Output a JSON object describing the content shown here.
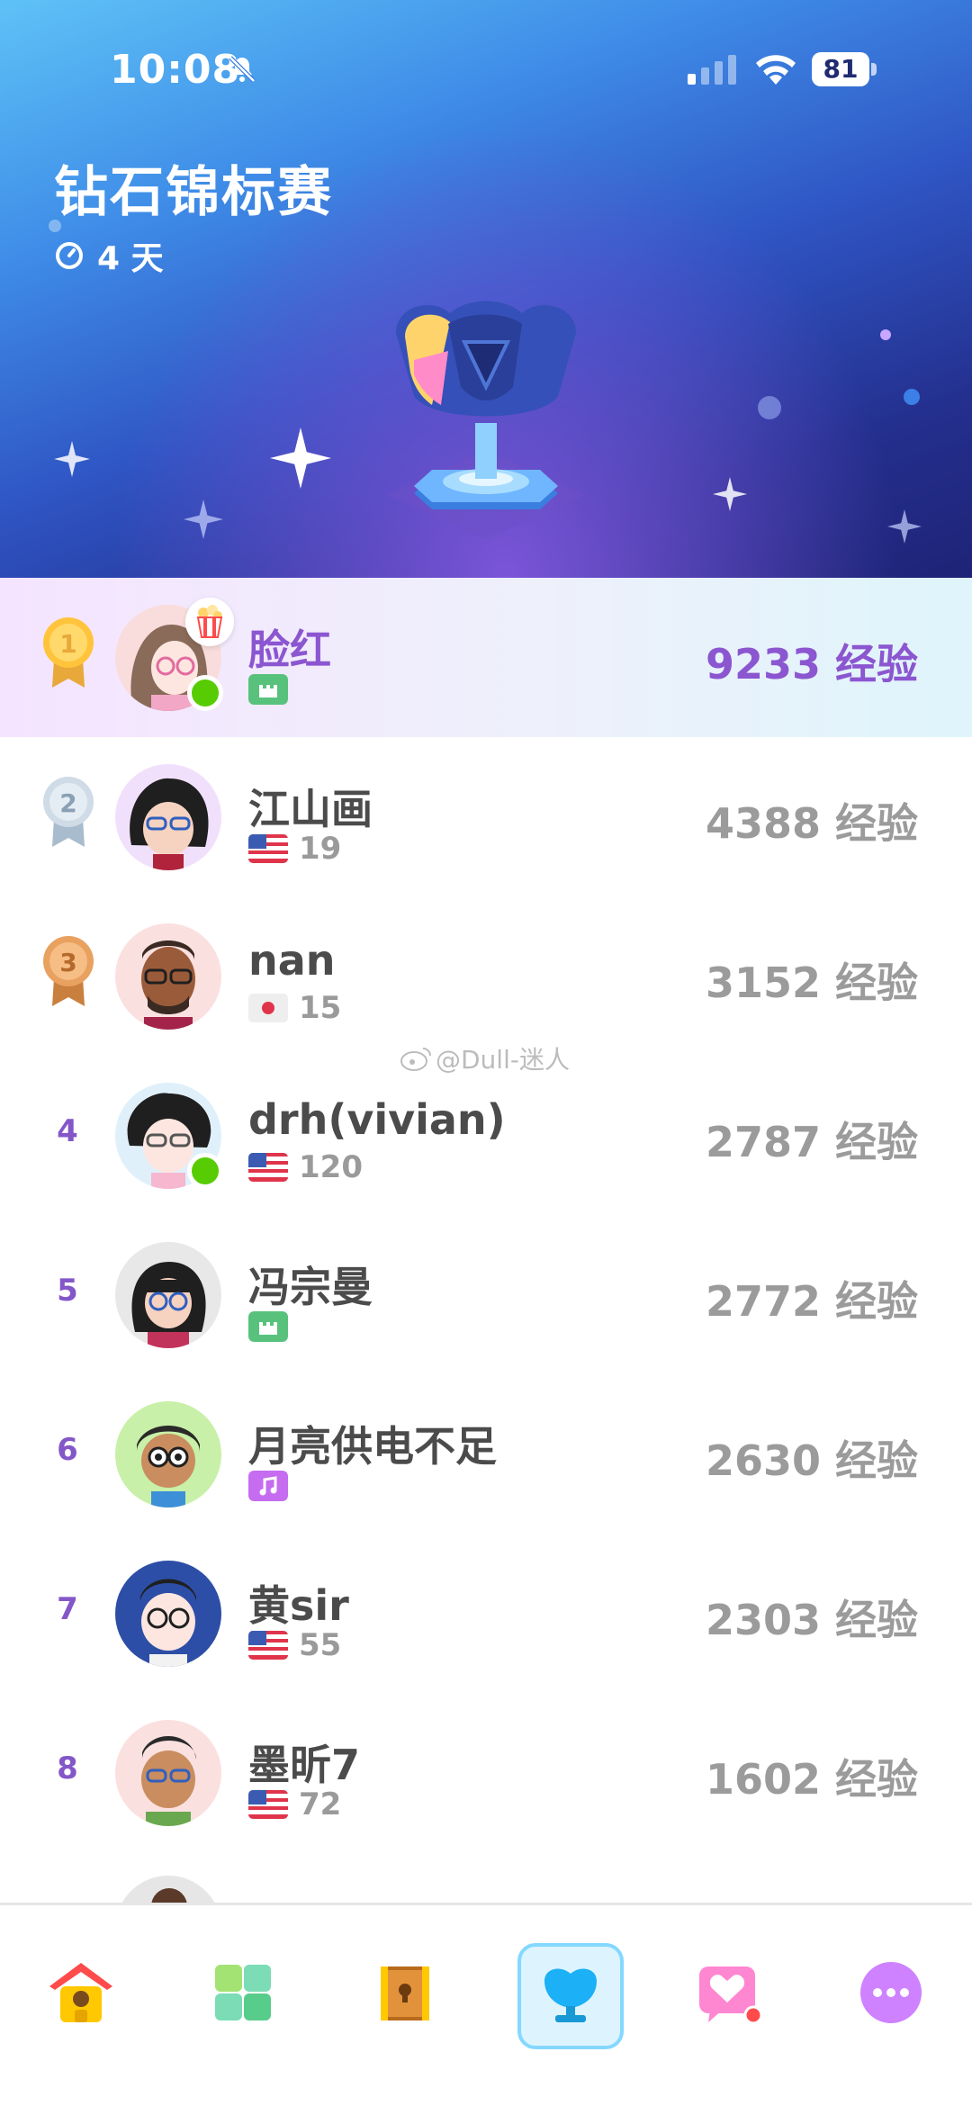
{
  "status_bar": {
    "time": "10:08",
    "battery": "81"
  },
  "header": {
    "title": "钻石锦标赛",
    "timer": "4 天"
  },
  "leaderboard": [
    {
      "rank": "1",
      "name": "脸红",
      "xp": "9233 经验",
      "sub_type": "tag",
      "tag_color": "#58c27d",
      "is_me": true,
      "online": true
    },
    {
      "rank": "2",
      "name": "江山画",
      "xp": "4388 经验",
      "sub_type": "flag",
      "flag": "us",
      "streak": "19"
    },
    {
      "rank": "3",
      "name": "nan",
      "xp": "3152 经验",
      "sub_type": "flag",
      "flag": "jp",
      "streak": "15"
    },
    {
      "rank": "4",
      "name": "drh(vivian)",
      "xp": "2787 经验",
      "sub_type": "flag",
      "flag": "us",
      "streak": "120",
      "online": true
    },
    {
      "rank": "5",
      "name": "冯宗曼",
      "xp": "2772 经验",
      "sub_type": "tag",
      "tag_color": "#58c27d"
    },
    {
      "rank": "6",
      "name": "月亮供电不足",
      "xp": "2630 经验",
      "sub_type": "tag",
      "tag_color": "#c56cf0"
    },
    {
      "rank": "7",
      "name": "黄sir",
      "xp": "2303 经验",
      "sub_type": "flag",
      "flag": "us",
      "streak": "55"
    },
    {
      "rank": "8",
      "name": "墨昕7",
      "xp": "1602 经验",
      "sub_type": "flag",
      "flag": "us",
      "streak": "72"
    }
  ],
  "watermark": "@Dull-迷人",
  "nav": {
    "items": [
      "home-icon",
      "practice-icon",
      "chest-icon",
      "leaderboard-icon",
      "friends-icon",
      "more-icon"
    ],
    "active_index": 3
  },
  "colors": {
    "accent": "#8b56d0",
    "xp_gray": "#9b9b9b",
    "online": "#58cc02"
  }
}
